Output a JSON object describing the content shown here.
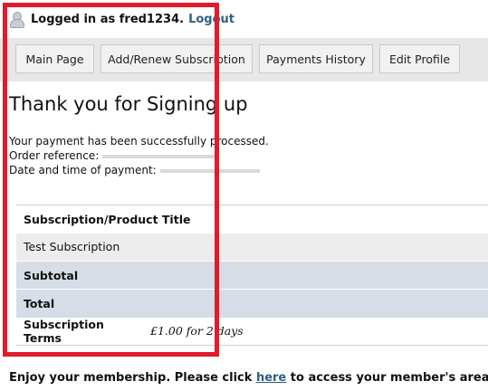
{
  "user_bar": {
    "logged_in_text": "Logged in as fred1234.",
    "logout_label": "Logout"
  },
  "nav": {
    "items": [
      {
        "label": "Main Page"
      },
      {
        "label": "Add/Renew Subscription"
      },
      {
        "label": "Payments History"
      },
      {
        "label": "Edit Profile"
      }
    ]
  },
  "page": {
    "title": "Thank you for Signing up",
    "payment_message": "Your payment has been successfully processed.",
    "order_reference_label": "Order reference:",
    "payment_date_label": "Date and time of payment:"
  },
  "summary": {
    "header_title": "Subscription/Product Title",
    "item_name": "Test Subscription",
    "subtotal_label": "Subtotal",
    "total_label": "Total",
    "terms_label": "Subscription Terms",
    "terms_value": "£1.00 for 2 days"
  },
  "footer": {
    "before": "Enjoy your membership. Please click ",
    "link": "here",
    "after": " to access your member's area."
  },
  "colors": {
    "highlight": "#e11b2a",
    "link": "#2f5f8a",
    "nav_bg": "#e7e7e7",
    "table_highlight_rows": "#d7dde6"
  }
}
